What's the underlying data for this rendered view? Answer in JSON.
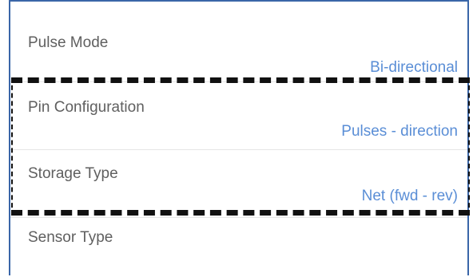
{
  "settings": {
    "rows": [
      {
        "title": "Pulse Mode",
        "value": "Bi-directional"
      },
      {
        "title": "Pin Configuration",
        "value": "Pulses - direction"
      },
      {
        "title": "Storage Type",
        "value": "Net (fwd - rev)"
      },
      {
        "title": "Sensor Type",
        "value": ""
      }
    ]
  },
  "colors": {
    "frame": "#3a66a8",
    "title_text": "#5f5f5f",
    "value_text": "#5a8ed6",
    "highlight_border": "#111111"
  }
}
